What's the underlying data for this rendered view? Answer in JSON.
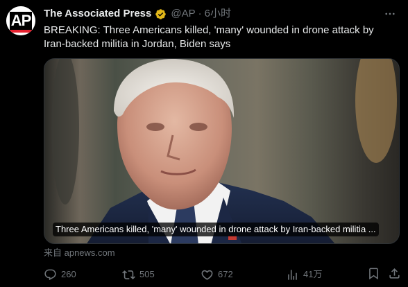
{
  "author": {
    "name": "The Associated Press",
    "handle": "@AP",
    "separator": "·",
    "time": "6小时",
    "avatar_text": "AP",
    "verified_color": "#e2b719"
  },
  "tweet": {
    "text": "BREAKING: Three Americans killed, 'many' wounded in drone attack by Iran-backed militia in Jordan, Biden says"
  },
  "card": {
    "caption": "Three Americans killed, 'many' wounded in drone attack by Iran-backed militia ...",
    "source": "来自 apnews.com"
  },
  "actions": {
    "replies": "260",
    "reposts": "505",
    "likes": "672",
    "views": "41万"
  },
  "icons": {
    "reply": "reply-icon",
    "repost": "repost-icon",
    "like": "heart-icon",
    "views": "views-icon",
    "bookmark": "bookmark-icon",
    "share": "share-icon",
    "more": "more-icon"
  },
  "colors": {
    "background": "#000000",
    "text": "#e7e9ea",
    "muted": "#71767b",
    "ap_red": "#e8212f"
  }
}
